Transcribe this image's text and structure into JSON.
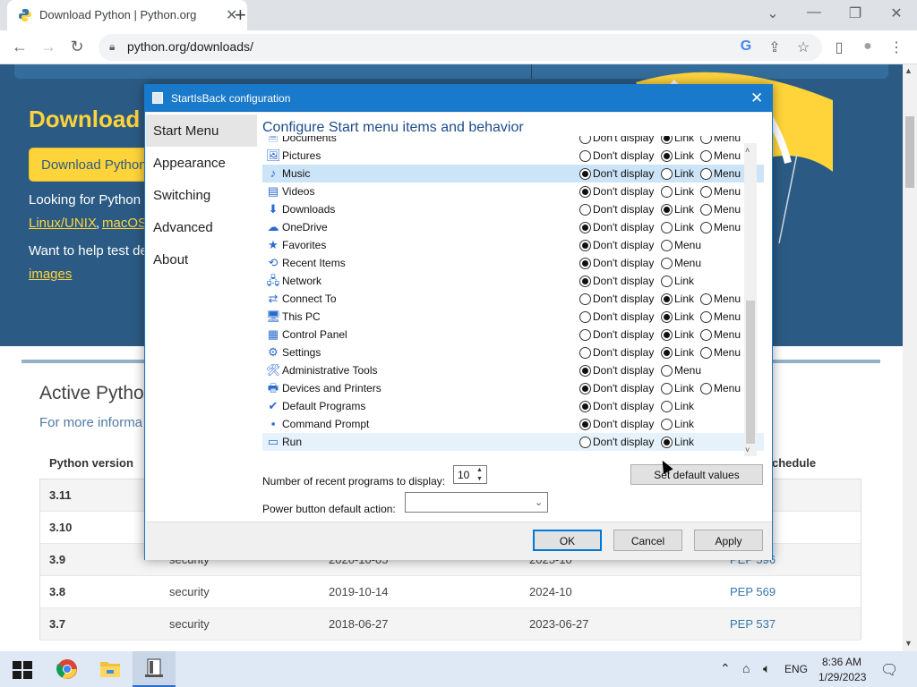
{
  "browser": {
    "tab_title": "Download Python | Python.org",
    "tab_close": "✕",
    "new_tab": "+",
    "url": "python.org/downloads/",
    "window_controls": {
      "dropdown": "⌄",
      "minimize": "—",
      "restore": "❐",
      "close": "✕"
    },
    "nav": {
      "back": "←",
      "forward": "→",
      "reload": "↻"
    },
    "toolbar_icons": {
      "google": "G",
      "share": "⇪",
      "bookmark": "☆",
      "sidebar": "▯",
      "profile": "●",
      "menu": "⋮"
    }
  },
  "page": {
    "title": "Download",
    "button_label": "Download Python",
    "line1": "Looking for Python",
    "link_linux": "Linux/UNIX",
    "comma": ",",
    "link_macos": "macOS",
    "line3": "Want to help test de",
    "link_images": "images",
    "active_title": "Active Python",
    "active_subtitle": "For more informa",
    "columns": {
      "version": "Python version",
      "schedule": "chedule"
    },
    "rows": [
      {
        "version": "3.11",
        "status": "",
        "released": "",
        "eol": "",
        "pep": ""
      },
      {
        "version": "3.10",
        "status": "",
        "released": "",
        "eol": "",
        "pep": ""
      },
      {
        "version": "3.9",
        "status": "security",
        "released": "2020-10-05",
        "eol": "2025-10",
        "pep": "PEP 596"
      },
      {
        "version": "3.8",
        "status": "security",
        "released": "2019-10-14",
        "eol": "2024-10",
        "pep": "PEP 569"
      },
      {
        "version": "3.7",
        "status": "security",
        "released": "2018-06-27",
        "eol": "2023-06-27",
        "pep": "PEP 537"
      }
    ]
  },
  "dialog": {
    "title": "StartIsBack configuration",
    "close": "✕",
    "sidebar": [
      "Start Menu",
      "Appearance",
      "Switching",
      "Advanced",
      "About"
    ],
    "heading": "Configure Start menu items and behavior",
    "option_labels": {
      "dont": "Don't display",
      "link": "Link",
      "menu": "Menu"
    },
    "items": [
      {
        "icon": "documents-icon",
        "glyph": "🗎",
        "label": "Documents",
        "options": [
          "dont",
          "link",
          "menu"
        ],
        "selected": "link"
      },
      {
        "icon": "pictures-icon",
        "glyph": "🖼",
        "label": "Pictures",
        "options": [
          "dont",
          "link",
          "menu"
        ],
        "selected": "link"
      },
      {
        "icon": "music-icon",
        "glyph": "♪",
        "label": "Music",
        "options": [
          "dont",
          "link",
          "menu"
        ],
        "selected": "dont"
      },
      {
        "icon": "videos-icon",
        "glyph": "▤",
        "label": "Videos",
        "options": [
          "dont",
          "link",
          "menu"
        ],
        "selected": "dont"
      },
      {
        "icon": "downloads-icon",
        "glyph": "⬇",
        "label": "Downloads",
        "options": [
          "dont",
          "link",
          "menu"
        ],
        "selected": "link"
      },
      {
        "icon": "onedrive-icon",
        "glyph": "☁",
        "label": "OneDrive",
        "options": [
          "dont",
          "link",
          "menu"
        ],
        "selected": "dont"
      },
      {
        "icon": "favorites-icon",
        "glyph": "★",
        "label": "Favorites",
        "options": [
          "dont",
          "menu"
        ],
        "selected": "dont"
      },
      {
        "icon": "recent-items-icon",
        "glyph": "⟲",
        "label": "Recent Items",
        "options": [
          "dont",
          "menu"
        ],
        "selected": "dont"
      },
      {
        "icon": "network-icon",
        "glyph": "🖧",
        "label": "Network",
        "options": [
          "dont",
          "link"
        ],
        "selected": "dont"
      },
      {
        "icon": "connect-to-icon",
        "glyph": "⇄",
        "label": "Connect To",
        "options": [
          "dont",
          "link",
          "menu"
        ],
        "selected": "link"
      },
      {
        "icon": "this-pc-icon",
        "glyph": "🖥",
        "label": "This PC",
        "options": [
          "dont",
          "link",
          "menu"
        ],
        "selected": "link"
      },
      {
        "icon": "control-panel-icon",
        "glyph": "▦",
        "label": "Control Panel",
        "options": [
          "dont",
          "link",
          "menu"
        ],
        "selected": "link"
      },
      {
        "icon": "settings-icon",
        "glyph": "⚙",
        "label": "Settings",
        "options": [
          "dont",
          "link",
          "menu"
        ],
        "selected": "link"
      },
      {
        "icon": "administrative-tools-icon",
        "glyph": "🛠",
        "label": "Administrative Tools",
        "options": [
          "dont",
          "menu"
        ],
        "selected": "dont"
      },
      {
        "icon": "devices-printers-icon",
        "glyph": "🖶",
        "label": "Devices and Printers",
        "options": [
          "dont",
          "link",
          "menu"
        ],
        "selected": "dont"
      },
      {
        "icon": "default-programs-icon",
        "glyph": "✔",
        "label": "Default Programs",
        "options": [
          "dont",
          "link"
        ],
        "selected": "dont"
      },
      {
        "icon": "command-prompt-icon",
        "glyph": "▪",
        "label": "Command Prompt",
        "options": [
          "dont",
          "link"
        ],
        "selected": "dont"
      },
      {
        "icon": "run-icon",
        "glyph": "▭",
        "label": "Run",
        "options": [
          "dont",
          "link"
        ],
        "selected": "link"
      }
    ],
    "recent_label": "Number of recent programs to display:",
    "recent_value": "10",
    "default_button": "Set default values",
    "power_label": "Power button default action:",
    "power_value": "",
    "ok": "OK",
    "cancel": "Cancel",
    "apply": "Apply"
  },
  "taskbar": {
    "language": "ENG",
    "time": "8:36 AM",
    "date": "1/29/2023"
  },
  "colors": {
    "python_blue": "#2b5b84",
    "python_yellow": "#ffd43b",
    "dialog_accent": "#1979ca"
  }
}
